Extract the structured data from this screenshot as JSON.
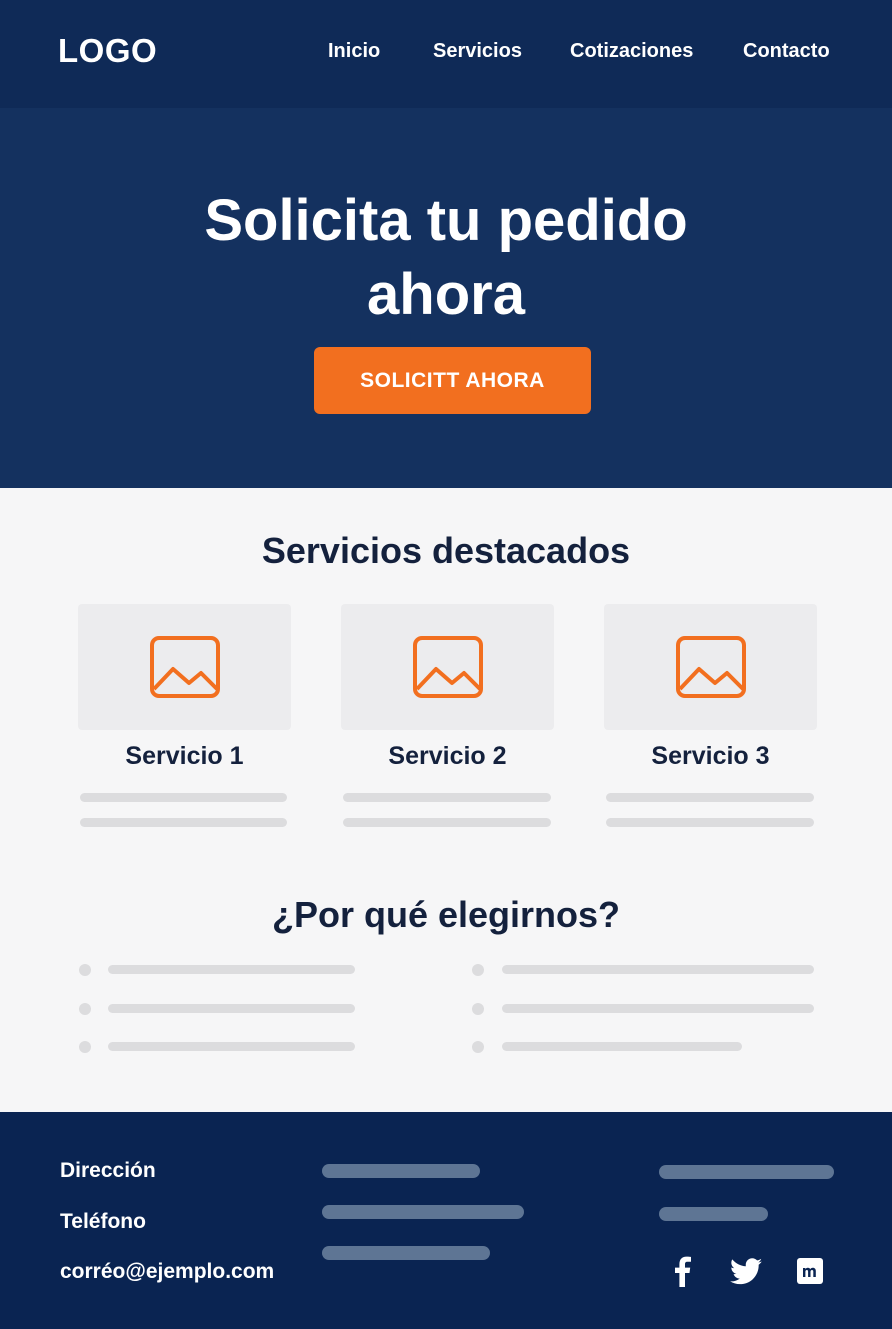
{
  "nav": {
    "logo": "LOGO",
    "links": [
      "Inicio",
      "Servicios",
      "Cotizaciones",
      "Contacto"
    ]
  },
  "hero": {
    "title_line1": "Solicita tu pedido",
    "title_line2": "ahora",
    "button_label": "SOLICITT AHORA"
  },
  "featured": {
    "title": "Servicios destacados",
    "cards": [
      {
        "title": "Servicio 1",
        "icon": "image-placeholder-icon"
      },
      {
        "title": "Servicio 2",
        "icon": "image-placeholder-icon"
      },
      {
        "title": "Servicio 3",
        "icon": "image-placeholder-icon"
      }
    ]
  },
  "why": {
    "title": "¿Por qué elegirnos?"
  },
  "footer": {
    "address": "Dirección",
    "phone": "Teléfono",
    "email": "corréo@ejemplo.com",
    "social_icons": [
      "facebook-icon",
      "twitter-icon",
      "linkedin-icon"
    ]
  },
  "colors": {
    "nav_bg": "#0f2a57",
    "hero_bg": "#14315f",
    "accent": "#f26f1f",
    "footer_bg": "#0a2452",
    "heading": "#14213d"
  }
}
